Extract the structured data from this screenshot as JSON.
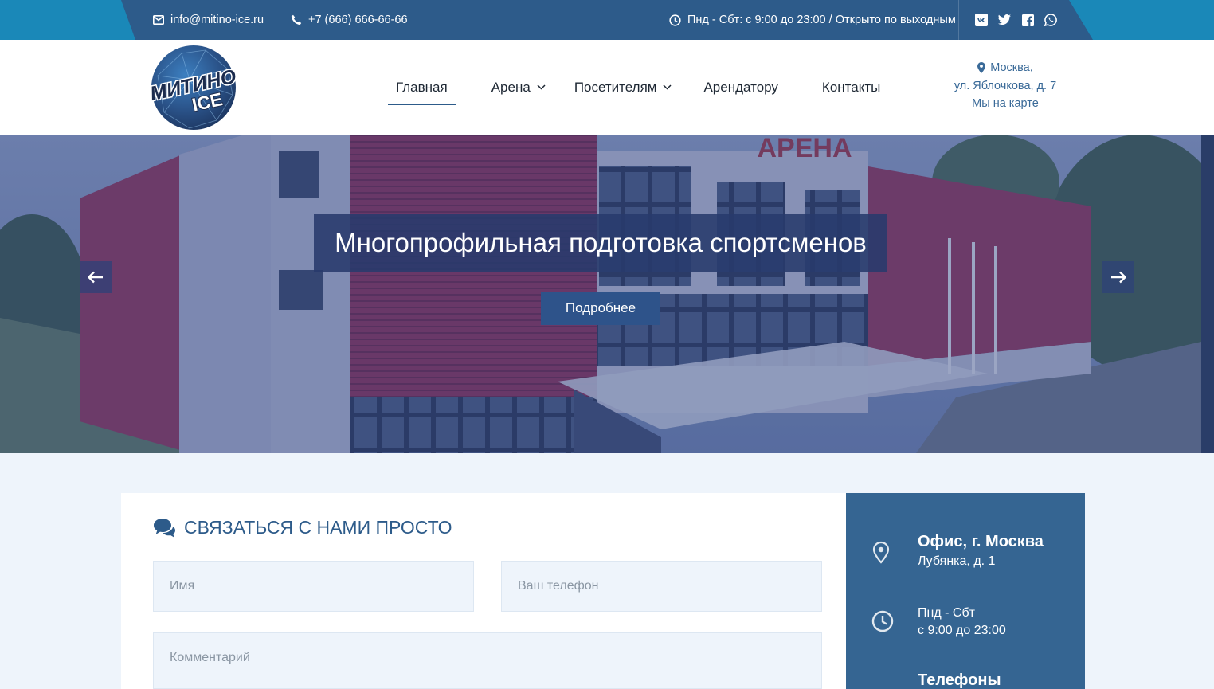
{
  "topbar": {
    "email": "info@mitino-ice.ru",
    "phone": "+7 (666) 666-66-66",
    "hours": "Пнд - Сбт: с 9:00 до 23:00 / Открыто по выходным",
    "social": [
      "vk-icon",
      "twitter-icon",
      "facebook-icon",
      "whatsapp-icon"
    ]
  },
  "logo": {
    "line1": "МИТИНО",
    "line2": "ICE"
  },
  "nav": {
    "items": [
      {
        "label": "Главная",
        "active": true
      },
      {
        "label": "Арена",
        "dropdown": true
      },
      {
        "label": "Посетителям",
        "dropdown": true
      },
      {
        "label": "Арендатору"
      },
      {
        "label": "Контакты"
      }
    ]
  },
  "address": {
    "city": "Москва,",
    "street": "ул. Яблочкова, д. 7",
    "map_link": "Мы на карте"
  },
  "hero": {
    "title": "Многопрофильная подготовка спортсменов",
    "button": "Подробнее",
    "building_sign": "АРЕНА"
  },
  "contact_form": {
    "title": "СВЯЗАТЬСЯ С НАМИ ПРОСТО",
    "name_placeholder": "Имя",
    "phone_placeholder": "Ваш телефон",
    "comment_placeholder": "Комментарий"
  },
  "sidebar": {
    "office_title": "Офис, г. Москва",
    "office_address": "Лубянка, д. 1",
    "hours_line1": "Пнд - Сбт",
    "hours_line2": "с 9:00 до 23:00",
    "phones_title": "Телефоны"
  },
  "colors": {
    "primary": "#2d5b8a",
    "accent": "#1a88b8",
    "sidebar": "#356592",
    "background": "#eef4fb"
  }
}
